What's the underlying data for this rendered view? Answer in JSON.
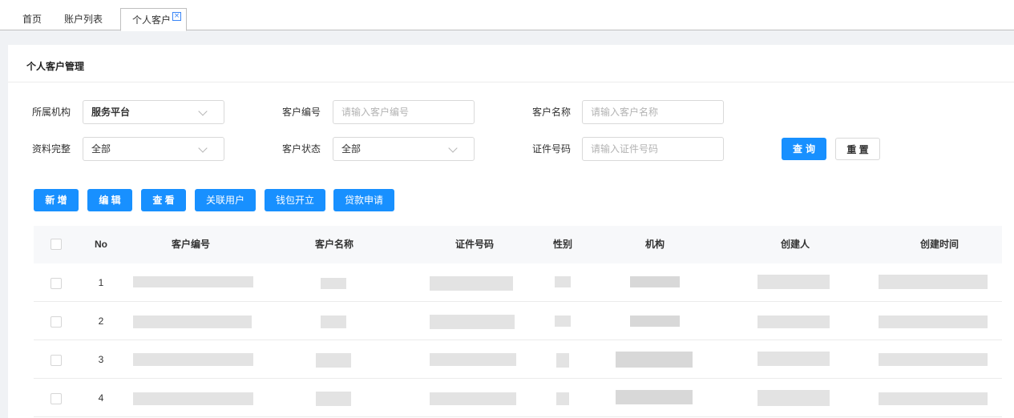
{
  "tabs": [
    {
      "label": "首页"
    },
    {
      "label": "账户列表"
    },
    {
      "label": "个人客户",
      "close_glyph": "×"
    }
  ],
  "panel": {
    "title": "个人客户管理"
  },
  "filters": {
    "org": {
      "label": "所属机构",
      "value": "服务平台"
    },
    "customer_no": {
      "label": "客户编号",
      "placeholder": "请输入客户编号"
    },
    "customer_name": {
      "label": "客户名称",
      "placeholder": "请输入客户名称"
    },
    "profile_complete": {
      "label": "资料完整",
      "value": "全部"
    },
    "customer_status": {
      "label": "客户状态",
      "value": "全部"
    },
    "id_number": {
      "label": "证件号码",
      "placeholder": "请输入证件号码"
    },
    "query_label": "查询",
    "reset_label": "重 置"
  },
  "actions": {
    "add": "新 增",
    "edit": "编 辑",
    "view": "查 看",
    "link_user": "关联用户",
    "open_wallet": "钱包开立",
    "loan_apply": "贷款申请"
  },
  "table": {
    "columns": [
      "No",
      "客户编号",
      "客户名称",
      "证件号码",
      "性别",
      "机构",
      "创建人",
      "创建时间"
    ],
    "rows": [
      {
        "no": "1"
      },
      {
        "no": "2"
      },
      {
        "no": "3"
      },
      {
        "no": "4"
      }
    ]
  },
  "colors": {
    "primary": "#1890ff",
    "tab_close": "#3a86f7"
  }
}
